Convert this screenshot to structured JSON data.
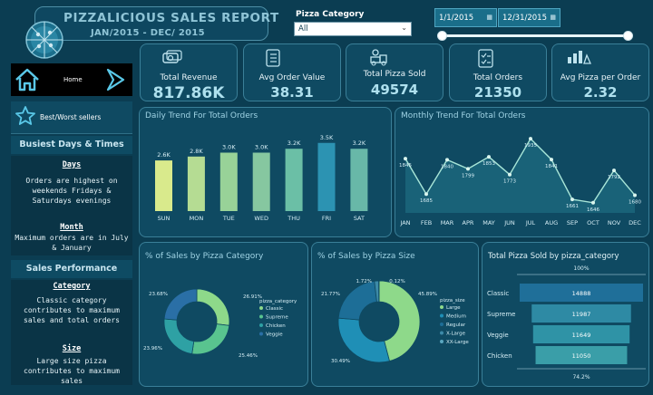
{
  "report": {
    "title": "PIZZALICIOUS SALES REPORT",
    "subtitle": "JAN/2015 - DEC/ 2015"
  },
  "filters": {
    "category_label": "Pizza Category",
    "category_value": "All",
    "start_date": "1/1/2015",
    "end_date": "12/31/2015"
  },
  "nav": {
    "home_label": "Home",
    "best_worst_label": "Best/Worst sellers"
  },
  "sidebar": {
    "busiest_heading": "Busiest Days & Times",
    "days_title": "Days",
    "days_text": [
      "Orders are highest on",
      "weekends Fridays &",
      "Saturdays evenings"
    ],
    "month_title": "Month",
    "month_text": [
      "Maximum orders are in July",
      "& January"
    ],
    "performance_heading": "Sales Performance",
    "category_title": "Category",
    "category_text": [
      "Classic category",
      "contributes to maximum",
      "sales and total orders"
    ],
    "size_title": "Size",
    "size_text": [
      "Large size pizza",
      "contributes to maximum",
      "sales"
    ]
  },
  "kpis": [
    {
      "label": "Total Revenue",
      "value": "817.86K",
      "icon": "money-icon"
    },
    {
      "label": "Avg Order Value",
      "value": "38.31",
      "icon": "list-icon"
    },
    {
      "label": "Total Pizza Sold",
      "value": "49574",
      "icon": "delivery-icon"
    },
    {
      "label": "Total Orders",
      "value": "21350",
      "icon": "checklist-icon"
    },
    {
      "label": "Avg Pizza per Order",
      "value": "2.32",
      "icon": "pizza-bars-icon"
    }
  ],
  "colors": {
    "background": "#0b3d52",
    "panel": "#0f4a62",
    "accent": "#8fc4d6"
  },
  "chart_data": [
    {
      "type": "bar",
      "title": "Daily Trend For Total Orders",
      "categories": [
        "SUN",
        "MON",
        "TUE",
        "WED",
        "THU",
        "FRI",
        "SAT"
      ],
      "values": [
        2.6,
        2.8,
        3.0,
        3.0,
        3.2,
        3.5,
        3.2
      ],
      "data_labels": [
        "2.6K",
        "2.8K",
        "3.0K",
        "3.0K",
        "3.2K",
        "3.5K",
        "3.2K"
      ],
      "colors": [
        "#d9ea8c",
        "#b5dc93",
        "#98d298",
        "#86c7a0",
        "#6bbfa6",
        "#2c93b2",
        "#68b8a8"
      ],
      "ylim": [
        0,
        4
      ]
    },
    {
      "type": "area",
      "title": "Monthly Trend For Total Orders",
      "categories": [
        "JAN",
        "FEB",
        "MAR",
        "APR",
        "MAY",
        "JUN",
        "JUL",
        "AUG",
        "SEP",
        "OCT",
        "NOV",
        "DEC"
      ],
      "values": [
        1845,
        1685,
        1840,
        1799,
        1853,
        1773,
        1935,
        1841,
        1661,
        1646,
        1792,
        1680
      ],
      "ylim": [
        1600,
        1960
      ]
    },
    {
      "type": "pie",
      "title": "% of Sales by Pizza Category",
      "legend_title": "pizza_category",
      "series": [
        {
          "name": "Classic",
          "value": 26.91,
          "label": "26.91%",
          "color": "#8ed98a"
        },
        {
          "name": "Supreme",
          "value": 25.46,
          "label": "25.46%",
          "color": "#59c48f"
        },
        {
          "name": "Chicken",
          "value": 23.96,
          "label": "23.96%",
          "color": "#2ea1a4"
        },
        {
          "name": "Veggie",
          "value": 23.68,
          "label": "23.68%",
          "color": "#2a6fa6"
        }
      ]
    },
    {
      "type": "pie",
      "title": "% of Sales by Pizza Size",
      "legend_title": "pizza_size",
      "series": [
        {
          "name": "Large",
          "value": 45.89,
          "label": "45.89%",
          "color": "#8ed98a"
        },
        {
          "name": "Medium",
          "value": 30.49,
          "label": "30.49%",
          "color": "#1f8fb6"
        },
        {
          "name": "Regular",
          "value": 21.77,
          "label": "21.77%",
          "color": "#1d6e97"
        },
        {
          "name": "X-Large",
          "value": 1.72,
          "label": "1.72%",
          "color": "#3c8aa8"
        },
        {
          "name": "XX-Large",
          "value": 0.12,
          "label": "0.12%",
          "color": "#5aa7c0"
        }
      ]
    },
    {
      "type": "bar",
      "orientation": "funnel",
      "title": "Total Pizza Sold by pizza_category",
      "categories": [
        "Classic",
        "Supreme",
        "Veggie",
        "Chicken"
      ],
      "values": [
        14888,
        11987,
        11649,
        11050
      ],
      "data_labels": [
        "14888",
        "11987",
        "11649",
        "11050"
      ],
      "top_label": "100%",
      "bottom_label": "74.2%",
      "colors": [
        "#1f6f99",
        "#2e8aa4",
        "#2f93a6",
        "#3a9ea8"
      ]
    }
  ]
}
